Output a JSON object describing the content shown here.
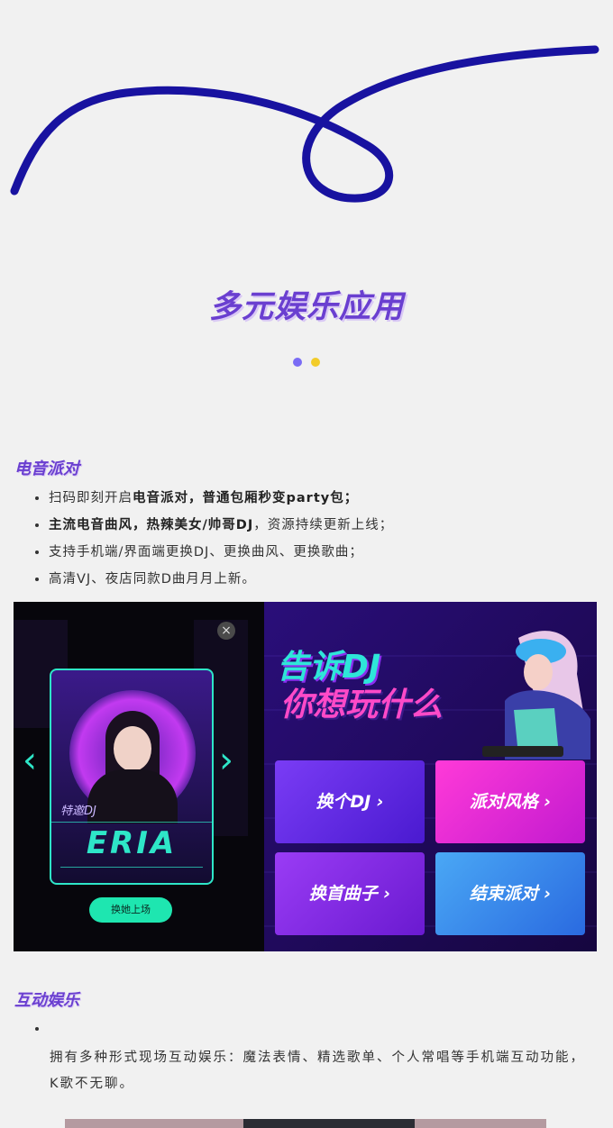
{
  "main_title": "多元娱乐应用",
  "colors": {
    "accent": "#6a3fd0",
    "swirl": "#1812a0",
    "dot1": "#7a6cf5",
    "dot2": "#f2cc2a"
  },
  "section1": {
    "title": "电音派对",
    "bullets": [
      {
        "plain_a": "扫码即刻开启",
        "bold": "电音派对，普通包厢秒变party包；",
        "plain_b": ""
      },
      {
        "plain_a": "",
        "bold": "主流电音曲风，热辣美女/帅哥DJ",
        "plain_b": "，资源持续更新上线；"
      },
      {
        "plain_a": "支持手机端/界面端更换DJ、更换曲风、更换歌曲；",
        "bold": "",
        "plain_b": ""
      },
      {
        "plain_a": "高清VJ、夜店同款D曲月月上新。",
        "bold": "",
        "plain_b": ""
      }
    ]
  },
  "promo": {
    "headline_line1": "告诉DJ",
    "headline_line2": "你想玩什么",
    "dj_tag": "特邀DJ",
    "dj_name": "ERIA",
    "switch_button": "换她上场",
    "close": "×",
    "arrow_left": "‹",
    "arrow_right": "›",
    "buttons": [
      {
        "label": "换个DJ ›",
        "color": "#6a2cf0"
      },
      {
        "label": "派对风格 ›",
        "color": "#e02ad8"
      },
      {
        "label": "换首曲子 ›",
        "color": "#8a2ff0"
      },
      {
        "label": "结束派对 ›",
        "color": "#3a8ff0"
      }
    ]
  },
  "section2": {
    "title": "互动娱乐",
    "paragraph": "拥有多种形式现场互动娱乐：魔法表情、精选歌单、个人常唱等手机端互动功能，K歌不无聊。"
  }
}
